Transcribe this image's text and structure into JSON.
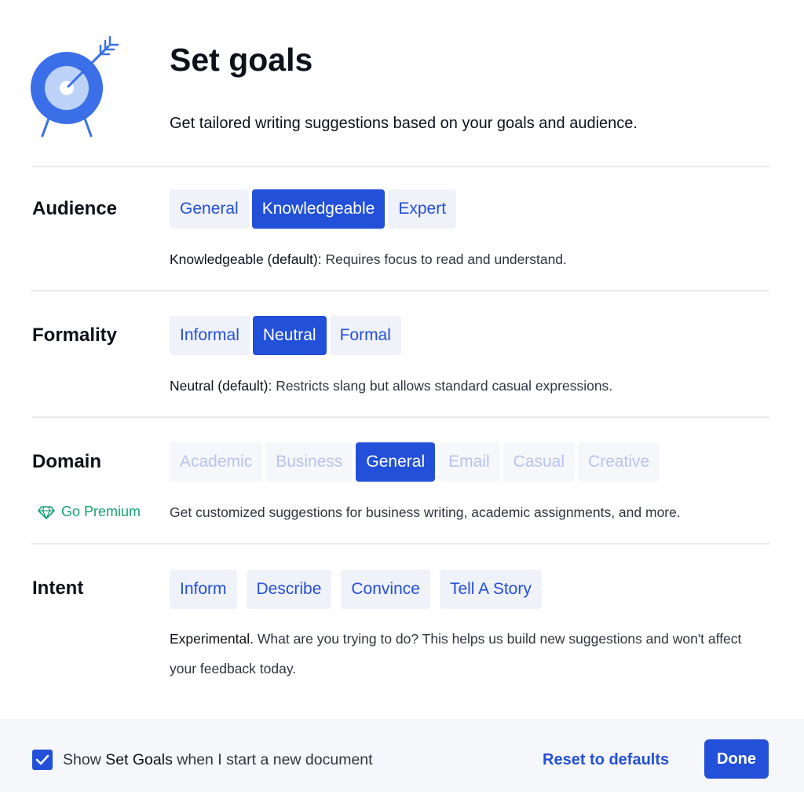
{
  "header": {
    "title": "Set goals",
    "subtitle": "Get tailored writing suggestions based on your goals and audience."
  },
  "audience": {
    "label": "Audience",
    "options": [
      "General",
      "Knowledgeable",
      "Expert"
    ],
    "selected": "Knowledgeable",
    "desc_strong": "Knowledgeable (default):",
    "desc_text": " Requires focus to read and understand."
  },
  "formality": {
    "label": "Formality",
    "options": [
      "Informal",
      "Neutral",
      "Formal"
    ],
    "selected": "Neutral",
    "desc_strong": "Neutral (default):",
    "desc_text": " Restricts slang but allows standard casual expressions."
  },
  "domain": {
    "label": "Domain",
    "options": [
      "Academic",
      "Business",
      "General",
      "Email",
      "Casual",
      "Creative"
    ],
    "selected": "General",
    "premium_label": "Go Premium",
    "desc_text": "Get customized suggestions for business writing, academic assignments, and more."
  },
  "intent": {
    "label": "Intent",
    "options": [
      "Inform",
      "Describe",
      "Convince",
      "Tell A Story"
    ],
    "desc_strong": "Experimental.",
    "desc_text": " What are you trying to do? This helps us build new suggestions and won't affect your feedback today."
  },
  "footer": {
    "checkbox_checked": true,
    "checkbox_prefix": "Show ",
    "checkbox_emph": "Set Goals",
    "checkbox_suffix": " when I start a new document",
    "reset_label": "Reset to defaults",
    "done_label": "Done"
  },
  "colors": {
    "accent": "#2350d8",
    "premium": "#15a36f",
    "option_bg": "#f0f2fa",
    "divider": "#e7e9ef"
  },
  "icons": {
    "header": "target-arrow-icon",
    "premium": "diamond-icon",
    "checkbox": "checkmark-icon"
  }
}
